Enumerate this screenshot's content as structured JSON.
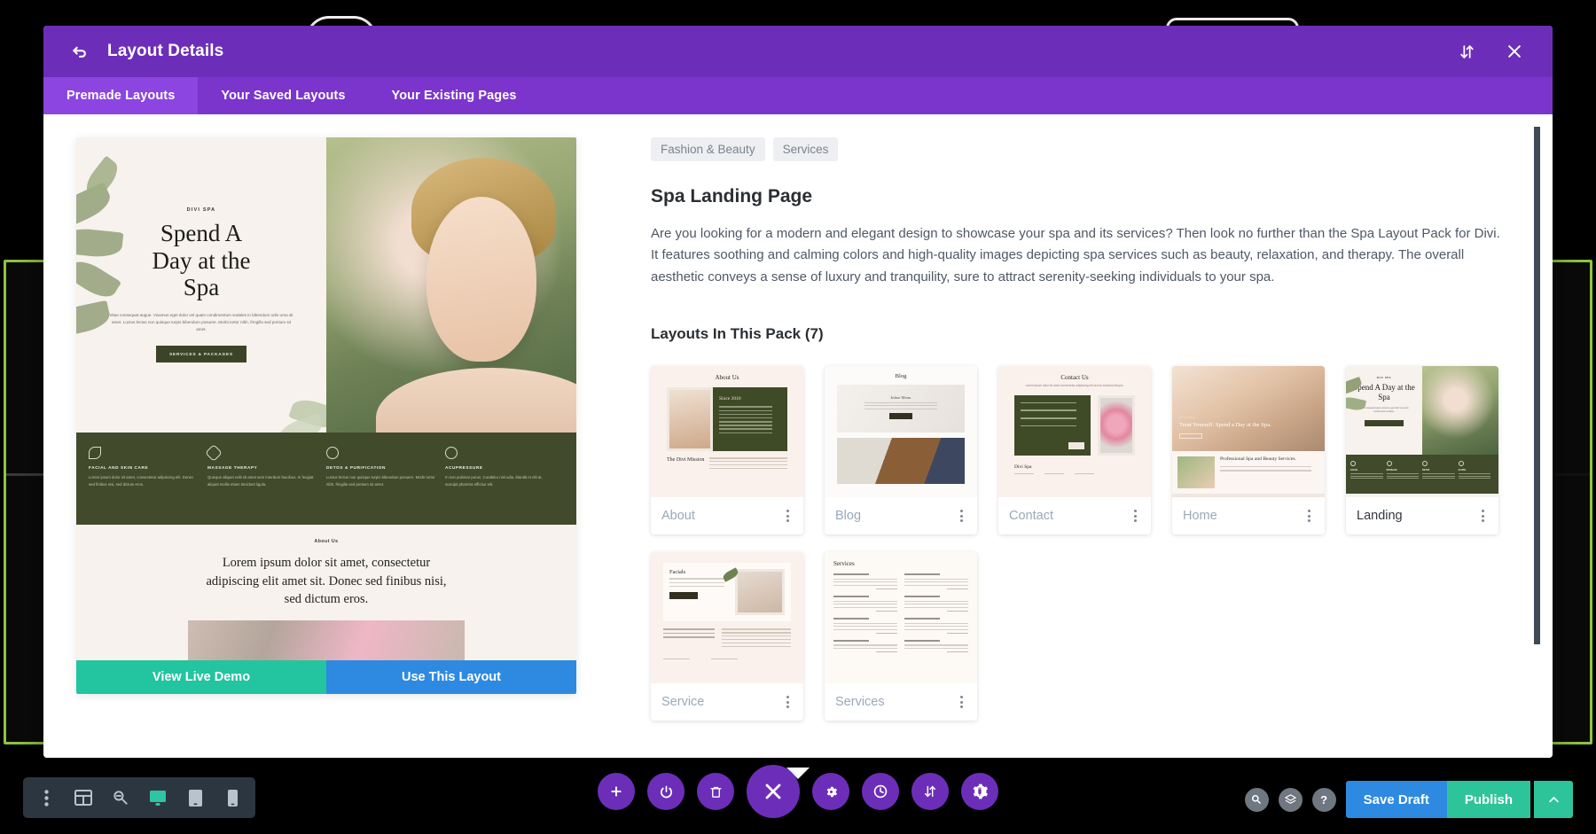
{
  "window": {
    "modal_title": "Layout Details",
    "back_icon": "back-arrow-icon",
    "sort_icon": "sort-icon",
    "close_icon": "close-icon"
  },
  "tabs": [
    {
      "label": "Premade Layouts",
      "active": true
    },
    {
      "label": "Your Saved Layouts",
      "active": false
    },
    {
      "label": "Your Existing Pages",
      "active": false
    }
  ],
  "preview": {
    "kicker": "DIVI SPA",
    "heading": "Spend A\nDay at the\nSpa",
    "heading_lines": [
      "Spend A",
      "Day at the",
      "Spa"
    ],
    "body": "Vitae consequat augue. Vivamus eget dolor vel quam condimentum sodales in bibendum odio urna sit amet. Luctus lectus non quisque turpis bibendum posuere. Morbi tortor nibh, fringilla sed pretium sit amet.",
    "cta": "SERVICES & PACKAGES",
    "features": [
      {
        "icon": "leaf-icon",
        "title": "FACIAL AND SKIN CARE",
        "body": "Lorem ipsum dolor sit amet, consectetur adipiscing elit. Donec sed finibus nisi, sed dictum eros."
      },
      {
        "icon": "star-icon",
        "title": "MASSAGE THERAPY",
        "body": "Quisque aliquet velit sit amet sem interdum faucibus. In feugiat aliquet mollis etiam tincidunt ligula."
      },
      {
        "icon": "atom-icon",
        "title": "DETOX & PURIFICATION",
        "body": "Luctus lectus non quisque turpis bibendum posuere. Morbi tortor nibh, fringilla sed pretium sit amet."
      },
      {
        "icon": "acupressure-icon",
        "title": "ACUPRESSURE",
        "body": "In non pulvinar purus. Curabitur nisl odio, blandit et elit at, suscipit pharetra efficitur elit."
      }
    ],
    "about_kicker": "About Us",
    "about_heading": "Lorem ipsum dolor sit amet, consectetur adipiscing elit amet sit. Donec sed finibus nisi, sed dictum eros.",
    "about_lines": [
      "Lorem ipsum dolor sit amet, consectetur",
      "adipiscing elit amet sit. Donec sed finibus nisi,",
      "sed dictum eros."
    ],
    "demo_button": "View Live Demo",
    "use_button": "Use This Layout"
  },
  "details": {
    "tags": [
      "Fashion & Beauty",
      "Services"
    ],
    "title": "Spa Landing Page",
    "description": "Are you looking for a modern and elegant design to showcase your spa and its services? Then look no further than the Spa Layout Pack for Divi. It features soothing and calming colors and high-quality images depicting spa services such as beauty, relaxation, and therapy. The overall aesthetic conveys a sense of luxury and tranquility, sure to attract serenity-seeking individuals to your spa.",
    "pack_heading": "Layouts In This Pack (7)",
    "layouts": [
      {
        "name": "About",
        "thumb_title": "About Us",
        "thumb_sub": "Since 2010",
        "active": false
      },
      {
        "name": "Blog",
        "thumb_title": "Blog",
        "thumb_sub": "Inline Menu",
        "active": false
      },
      {
        "name": "Contact",
        "thumb_title": "Contact Us",
        "thumb_sub": "Divi Spa",
        "active": false
      },
      {
        "name": "Home",
        "thumb_title": "",
        "thumb_sub": "Treat Yourself. Spend a Day at the Spa.",
        "active": false
      },
      {
        "name": "Landing",
        "thumb_title": "",
        "thumb_sub": "Spend A Day at the Spa",
        "active": true
      },
      {
        "name": "Service",
        "thumb_title": "Facials",
        "thumb_sub": "",
        "active": false
      },
      {
        "name": "Services",
        "thumb_title": "Services",
        "thumb_sub": "",
        "active": false
      }
    ],
    "kebab_icon": "more-options-icon",
    "home_overlay_kicker": "Professional Spa and Beauty Services."
  },
  "left_toolbar": [
    {
      "icon": "more-vertical-icon",
      "active": false
    },
    {
      "icon": "wireframe-icon",
      "active": false
    },
    {
      "icon": "zoom-out-icon",
      "active": false
    },
    {
      "icon": "desktop-icon",
      "active": true
    },
    {
      "icon": "tablet-icon",
      "active": false
    },
    {
      "icon": "phone-icon",
      "active": false
    }
  ],
  "dock": [
    {
      "icon": "plus-icon",
      "big": false
    },
    {
      "icon": "power-icon",
      "big": false
    },
    {
      "icon": "trash-icon",
      "big": false
    },
    {
      "icon": "close-x-icon",
      "big": true
    },
    {
      "icon": "gear-icon",
      "big": false
    },
    {
      "icon": "history-icon",
      "big": false
    },
    {
      "icon": "sort-icon",
      "big": false
    },
    {
      "icon": "plugin-gear-icon",
      "big": false
    }
  ],
  "right_actions": {
    "icons": [
      {
        "icon": "search-icon",
        "glyph": "⌕"
      },
      {
        "icon": "layers-icon",
        "glyph": "≣"
      },
      {
        "icon": "help-icon",
        "glyph": "?"
      }
    ],
    "save_draft": "Save Draft",
    "publish": "Publish",
    "expand_icon": "chevron-up-icon"
  },
  "colors": {
    "modal_header": "#6c2eb9",
    "tab_bar": "#7b35cd",
    "tab_active": "#8c45e0",
    "demo_green": "#23c4a0",
    "use_blue": "#2d8ae0",
    "publish_green": "#2ec49a",
    "spa_dark_green": "#414a2b",
    "accent_lime": "#8ec63f"
  }
}
